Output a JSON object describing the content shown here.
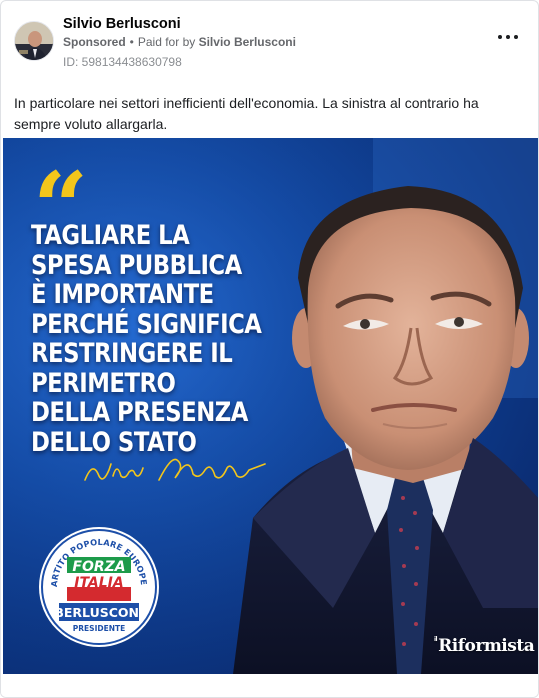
{
  "post": {
    "author": "Silvio Berlusconi",
    "sponsored_label": "Sponsored",
    "paid_for_prefix": "Paid for by",
    "paid_for_by": "Silvio Berlusconi",
    "id_text": "ID: 598134438630798",
    "body_text": "In particolare nei settori inefficienti dell'economia. La sinistra al contrario ha sempre voluto allargarla.",
    "more_icon": "more-horizontal-icon"
  },
  "image": {
    "quote_mark": "“",
    "quote_lines": [
      "TAGLIARE LA",
      "SPESA PUBBLICA",
      "È IMPORTANTE",
      "PERCHÉ SIGNIFICA",
      "RESTRINGERE IL",
      "PERIMETRO",
      "DELLA PRESENZA",
      "DELLO STATO"
    ],
    "logo": {
      "ring_text": "PARTITO POPOLARE EUROPEO",
      "party_line1": "FORZA",
      "party_line2": "ITALIA",
      "leader": "BERLUSCONI",
      "role": "PRESIDENTE"
    },
    "watermark_prefix": "il",
    "watermark": "Riformista",
    "colors": {
      "background_blue": "#124aa6",
      "quote_yellow": "#f3c61b",
      "logo_blue": "#1d4fa8",
      "logo_red": "#d42a2f",
      "logo_green": "#1d9b4a"
    }
  }
}
